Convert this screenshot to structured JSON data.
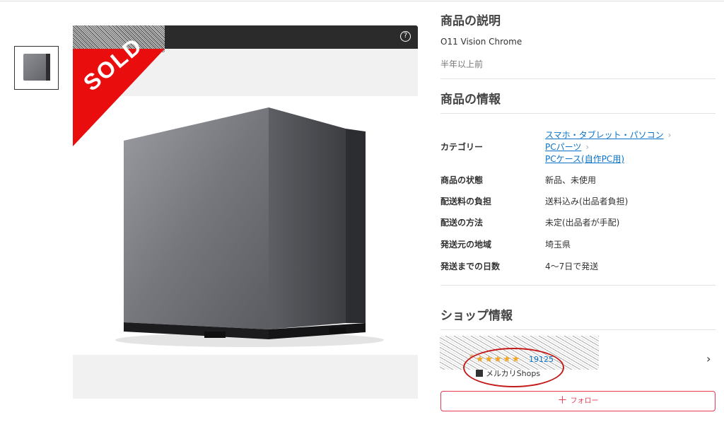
{
  "item": {
    "sold_label": "SOLD",
    "help_icon": "question-circle-icon"
  },
  "description": {
    "title": "商品の説明",
    "text": "O11 Vision Chrome",
    "posted": "半年以上前"
  },
  "info": {
    "title": "商品の情報",
    "category_label": "カテゴリー",
    "categories": [
      "スマホ・タブレット・パソコン",
      "PCパーツ",
      "PCケース(自作PC用)"
    ],
    "rows": [
      {
        "label": "商品の状態",
        "value": "新品、未使用"
      },
      {
        "label": "配送料の負担",
        "value": "送料込み(出品者負担)"
      },
      {
        "label": "配送の方法",
        "value": "未定(出品者が手配)"
      },
      {
        "label": "発送元の地域",
        "value": "埼玉県"
      },
      {
        "label": "発送までの日数",
        "value": "4〜7日で発送"
      }
    ]
  },
  "shop": {
    "title": "ショップ情報",
    "stars": "★★★★★",
    "rating": 5,
    "review_count": "19125",
    "badge": "メルカリShops",
    "follow_label": "フォロー",
    "highlight_color": "#c41a1a"
  },
  "colors": {
    "sold": "#ea0d0d",
    "link": "#0a73c9",
    "follow": "#ea3a52",
    "star": "#f5a623"
  }
}
